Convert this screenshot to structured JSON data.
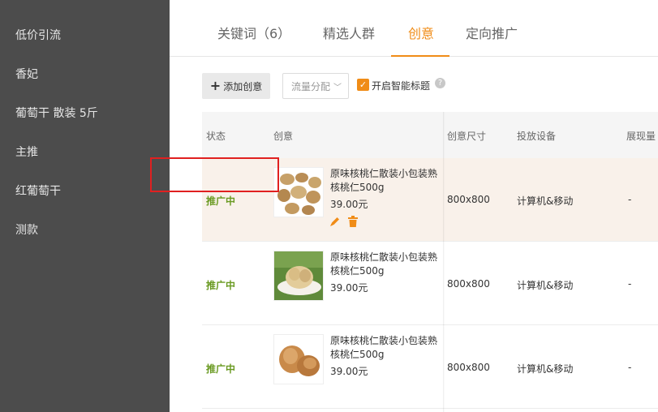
{
  "sidebar": {
    "items": [
      {
        "label": "低价引流"
      },
      {
        "label": "香妃"
      },
      {
        "label": "葡萄干 散装 5斤"
      },
      {
        "label": "主推"
      },
      {
        "label": "红葡萄干"
      },
      {
        "label": "测款"
      }
    ]
  },
  "tabs": [
    {
      "label": "关键词（6）",
      "active": false
    },
    {
      "label": "精选人群",
      "active": false
    },
    {
      "label": "创意",
      "active": true
    },
    {
      "label": "定向推广",
      "active": false
    }
  ],
  "toolbar": {
    "add_label": "添加创意",
    "select_value": "流量分配",
    "smart_title_label": "开启智能标题",
    "smart_title_checked": true
  },
  "table": {
    "headers": {
      "status": "状态",
      "creative": "创意",
      "size": "创意尺寸",
      "device": "投放设备",
      "impressions": "展现量"
    },
    "rows": [
      {
        "status": "推广中",
        "title": "原味核桃仁散装小包装熟核桃仁500g",
        "price": "39.00元",
        "size": "800x800",
        "device": "计算机&移动",
        "impressions": "-"
      },
      {
        "status": "推广中",
        "title": "原味核桃仁散装小包装熟核桃仁500g",
        "price": "39.00元",
        "size": "800x800",
        "device": "计算机&移动",
        "impressions": "-"
      },
      {
        "status": "推广中",
        "title": "原味核桃仁散装小包装熟核桃仁500g",
        "price": "39.00元",
        "size": "800x800",
        "device": "计算机&移动",
        "impressions": "-"
      }
    ]
  },
  "colors": {
    "sidebar_bg": "#4c4c4c",
    "accent": "#f08c17",
    "status_active": "#6a9a22",
    "row_highlight": "#f9f1ea",
    "annotation_box": "#e02020"
  }
}
